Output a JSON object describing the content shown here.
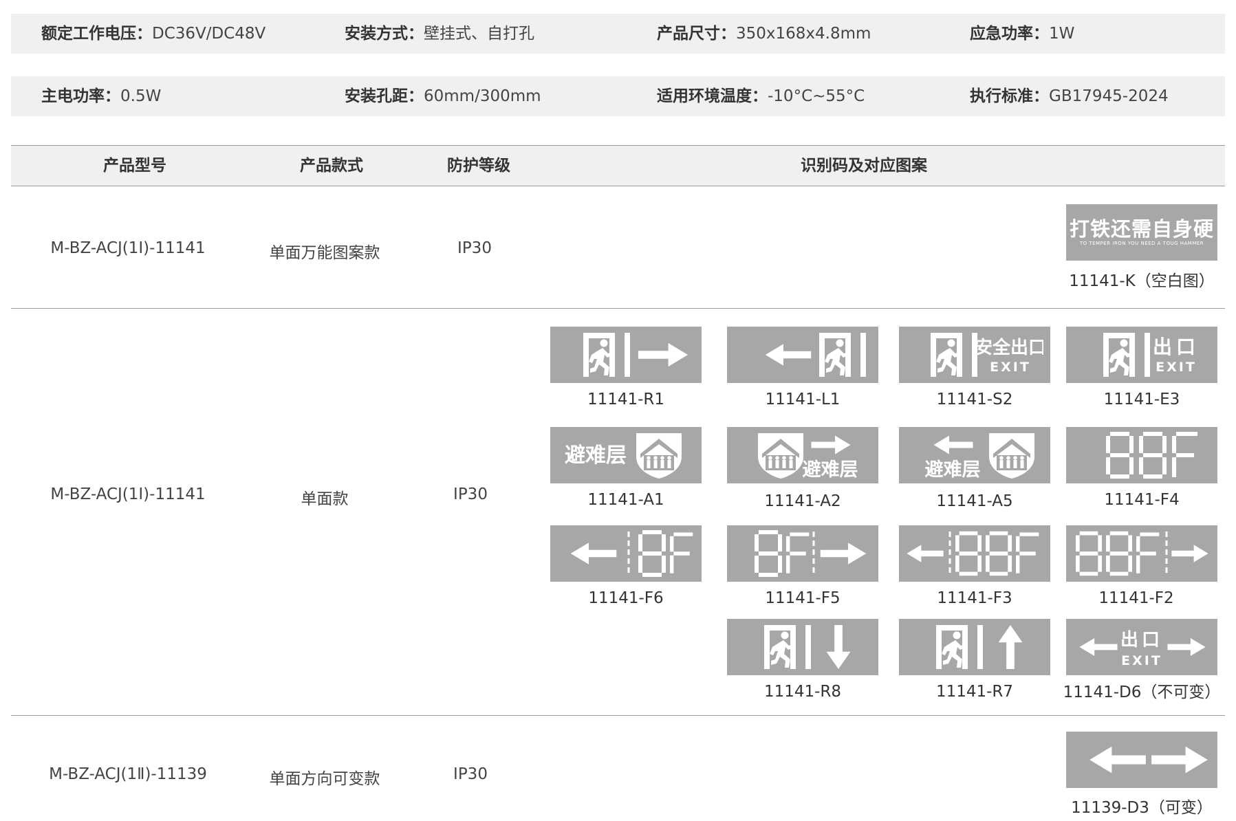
{
  "specs": {
    "row1": [
      {
        "k": "额定工作电压：",
        "v": "DC36V/DC48V"
      },
      {
        "k": "安装方式：",
        "v": "壁挂式、自打孔"
      },
      {
        "k": "产品尺寸：",
        "v": "350x168x4.8mm"
      },
      {
        "k": "应急功率：",
        "v": "1W"
      }
    ],
    "row2": [
      {
        "k": "主电功率：",
        "v": "0.5W"
      },
      {
        "k": "安装孔距：",
        "v": "60mm/300mm"
      },
      {
        "k": "适用环境温度：",
        "v": "-10°C~55°C"
      },
      {
        "k": "执行标准：",
        "v": "GB17945-2024"
      }
    ]
  },
  "table": {
    "headers": [
      "产品型号",
      "产品款式",
      "防护等级",
      "识别码及对应图案"
    ],
    "rows": [
      {
        "model": "M-BZ-ACJ(1Ⅰ)-11141",
        "style": "单面万能图案款",
        "ip": "IP30"
      },
      {
        "model": "M-BZ-ACJ(1Ⅰ)-11141",
        "style": "单面款",
        "ip": "IP30"
      },
      {
        "model": "M-BZ-ACJ(1Ⅱ)-11139",
        "style": "单面方向可变款",
        "ip": "IP30"
      }
    ]
  },
  "signs": {
    "K": {
      "code": "11141-K（空白图）",
      "slogan": "打铁还需自身硬",
      "slogan_en": "TO TEMPER IRON  YOU NEED A TOUG HAMMER"
    },
    "R1": {
      "code": "11141-R1",
      "icon": "exit-person-arrow-right"
    },
    "L1": {
      "code": "11141-L1",
      "icon": "arrow-left-exit-person"
    },
    "S2": {
      "code": "11141-S2",
      "icon": "exit-person-anquanchukou",
      "text": "安全出口",
      "text_en": "EXIT"
    },
    "E3": {
      "code": "11141-E3",
      "icon": "exit-person-chukou",
      "text": "出口",
      "text_en": "EXIT"
    },
    "A1": {
      "code": "11141-A1",
      "icon": "refuge-floor-shield",
      "text": "避难层"
    },
    "A2": {
      "code": "11141-A2",
      "icon": "refuge-shield-arrow-right",
      "text": "避难层"
    },
    "A5": {
      "code": "11141-A5",
      "icon": "arrow-left-refuge-shield",
      "text": "避难层"
    },
    "F4": {
      "code": "11141-F4",
      "icon": "floor-digits",
      "text": "88F"
    },
    "F6": {
      "code": "11141-F6",
      "icon": "arrow-left-floor",
      "text": "8F"
    },
    "F5": {
      "code": "11141-F5",
      "icon": "floor-arrow-right",
      "text": "8F"
    },
    "F3": {
      "code": "11141-F3",
      "icon": "arrow-left-floor",
      "text": "88F"
    },
    "F2": {
      "code": "11141-F2",
      "icon": "floor-arrow-right",
      "text": "88F"
    },
    "R8": {
      "code": "11141-R8",
      "icon": "exit-person-arrow-down"
    },
    "R7": {
      "code": "11141-R7",
      "icon": "exit-person-arrow-up"
    },
    "D6": {
      "code": "11141-D6（不可变）",
      "icon": "arrow-left-chukou-arrow-right",
      "text": "出口",
      "text_en": "EXIT"
    },
    "D3": {
      "code": "11139-D3（可变）",
      "icon": "double-arrow"
    }
  },
  "colors": {
    "sign_bg": "#a7a7a7",
    "row_bg": "#f0f0f0",
    "rule": "#9a9a9a"
  }
}
